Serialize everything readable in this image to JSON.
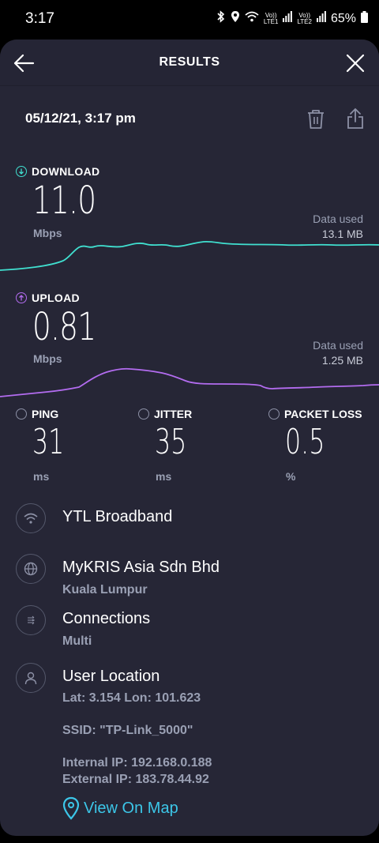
{
  "status": {
    "time": "3:17",
    "battery": "65%",
    "net1": "LTE1",
    "net2": "LTE2",
    "volte": "Vo))"
  },
  "header": {
    "title": "RESULTS"
  },
  "test": {
    "datetime": "05/12/21, 3:17 pm"
  },
  "download": {
    "label": "DOWNLOAD",
    "value": "11.0",
    "unit": "Mbps",
    "data_used_label": "Data used",
    "data_used": "13.1 MB",
    "color": "#40e0d0"
  },
  "upload": {
    "label": "UPLOAD",
    "value": "0.81",
    "unit": "Mbps",
    "data_used_label": "Data used",
    "data_used": "1.25 MB",
    "color": "#b36cf0"
  },
  "ping": {
    "label": "PING",
    "value": "31",
    "unit": "ms"
  },
  "jitter": {
    "label": "JITTER",
    "value": "35",
    "unit": "ms"
  },
  "packet_loss": {
    "label": "PACKET LOSS",
    "value": "0.5",
    "unit": "%"
  },
  "isp": {
    "name": "YTL Broadband"
  },
  "server": {
    "name": "MyKRIS Asia Sdn Bhd",
    "city": "Kuala Lumpur"
  },
  "connections": {
    "title": "Connections",
    "value": "Multi"
  },
  "location": {
    "title": "User Location",
    "coords": "Lat: 3.154 Lon: 101.623",
    "ssid": "SSID: \"TP-Link_5000\"",
    "internal_ip": "Internal IP: 192.168.0.188",
    "external_ip": "External IP: 183.78.44.92"
  },
  "map_link": {
    "label": "View On Map"
  }
}
